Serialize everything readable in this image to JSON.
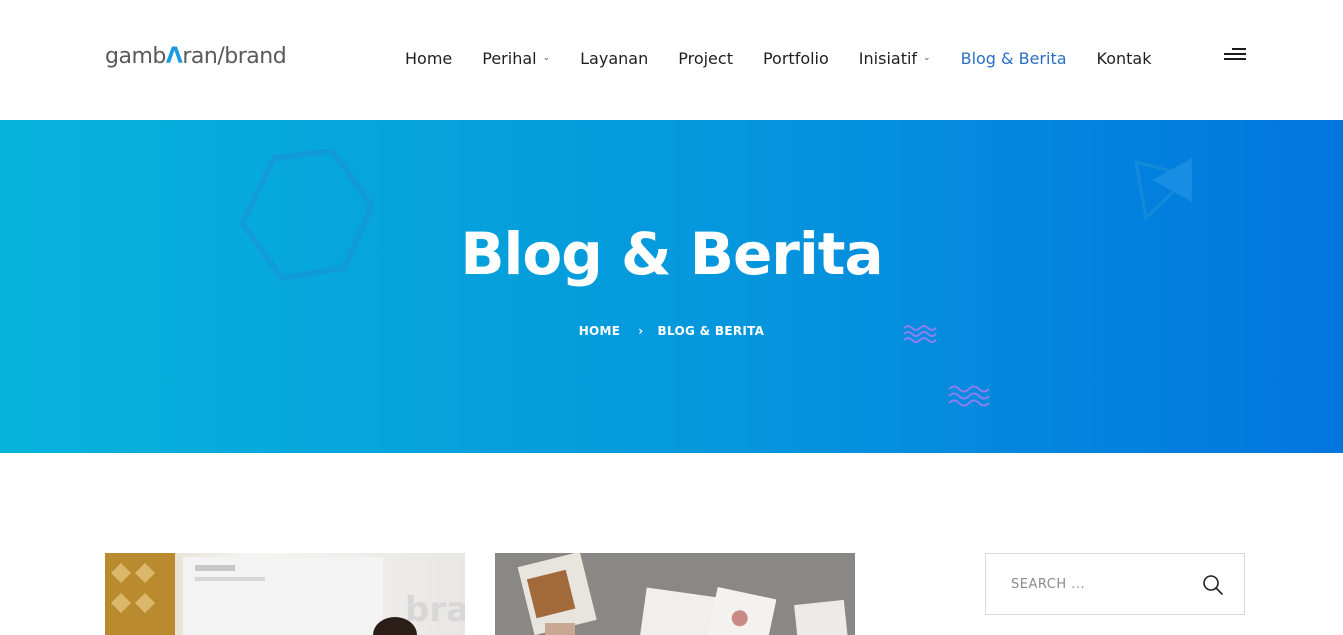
{
  "header": {
    "logo": {
      "part1": "gamb",
      "part2": "Λ",
      "part3": "ran",
      "part4": "/",
      "part5": "brand"
    },
    "nav": [
      {
        "label": "Home",
        "has_dropdown": false,
        "active": false
      },
      {
        "label": "Perihal",
        "has_dropdown": true,
        "active": false
      },
      {
        "label": "Layanan",
        "has_dropdown": false,
        "active": false
      },
      {
        "label": "Project",
        "has_dropdown": false,
        "active": false
      },
      {
        "label": "Portfolio",
        "has_dropdown": false,
        "active": false
      },
      {
        "label": "Inisiatif",
        "has_dropdown": true,
        "active": false
      },
      {
        "label": "Blog & Berita",
        "has_dropdown": false,
        "active": true
      },
      {
        "label": "Kontak",
        "has_dropdown": false,
        "active": false
      }
    ],
    "menu_icon": "hamburger-menu-icon"
  },
  "hero": {
    "title": "Blog & Berita",
    "breadcrumb": {
      "home": "HOME",
      "separator": "›",
      "current": "BLOG & BERITA"
    }
  },
  "sidebar": {
    "search": {
      "placeholder": "SEARCH ...",
      "value": "",
      "icon": "search-icon"
    }
  },
  "colors": {
    "accent": "#2a6fc4",
    "hero_start": "#06b4db",
    "hero_end": "#0176df"
  }
}
